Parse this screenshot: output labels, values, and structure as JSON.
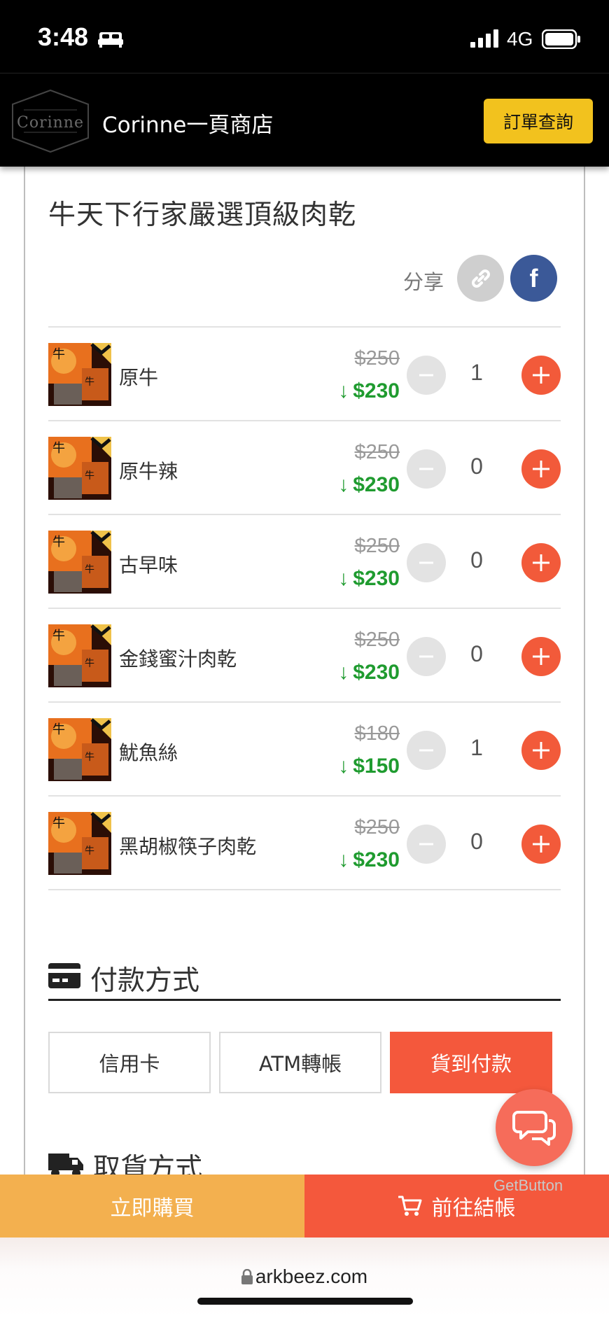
{
  "status_bar": {
    "time": "3:48",
    "network": "4G"
  },
  "header": {
    "logo_text": "Corinne",
    "store_title": "Corinne一頁商店",
    "order_query_label": "訂單查詢"
  },
  "product": {
    "title": "牛天下行家嚴選頂級肉乾",
    "share_label": "分享"
  },
  "items": [
    {
      "name": "原牛",
      "original_price": "$250",
      "sale_price": "$230",
      "qty": "1"
    },
    {
      "name": "原牛辣",
      "original_price": "$250",
      "sale_price": "$230",
      "qty": "0"
    },
    {
      "name": "古早味",
      "original_price": "$250",
      "sale_price": "$230",
      "qty": "0"
    },
    {
      "name": "金錢蜜汁肉乾",
      "original_price": "$250",
      "sale_price": "$230",
      "qty": "0"
    },
    {
      "name": "魷魚絲",
      "original_price": "$180",
      "sale_price": "$150",
      "qty": "1"
    },
    {
      "name": "黑胡椒筷子肉乾",
      "original_price": "$250",
      "sale_price": "$230",
      "qty": "0"
    }
  ],
  "payment": {
    "title": "付款方式",
    "options": [
      "信用卡",
      "ATM轉帳",
      "貨到付款"
    ],
    "selected": "貨到付款"
  },
  "pickup": {
    "title": "取貨方式"
  },
  "chat": {
    "getbutton_label": "GetButton"
  },
  "bottom_bar": {
    "buy_now_label": "立即購買",
    "checkout_label": "前往結帳"
  },
  "browser": {
    "url": "arkbeez.com"
  },
  "colors": {
    "accent_orange": "#f4583c",
    "accent_yellow": "#f2c21e",
    "buy_now": "#f3b04f",
    "sale_green": "#1f9b2f",
    "facebook_blue": "#3b5998"
  }
}
